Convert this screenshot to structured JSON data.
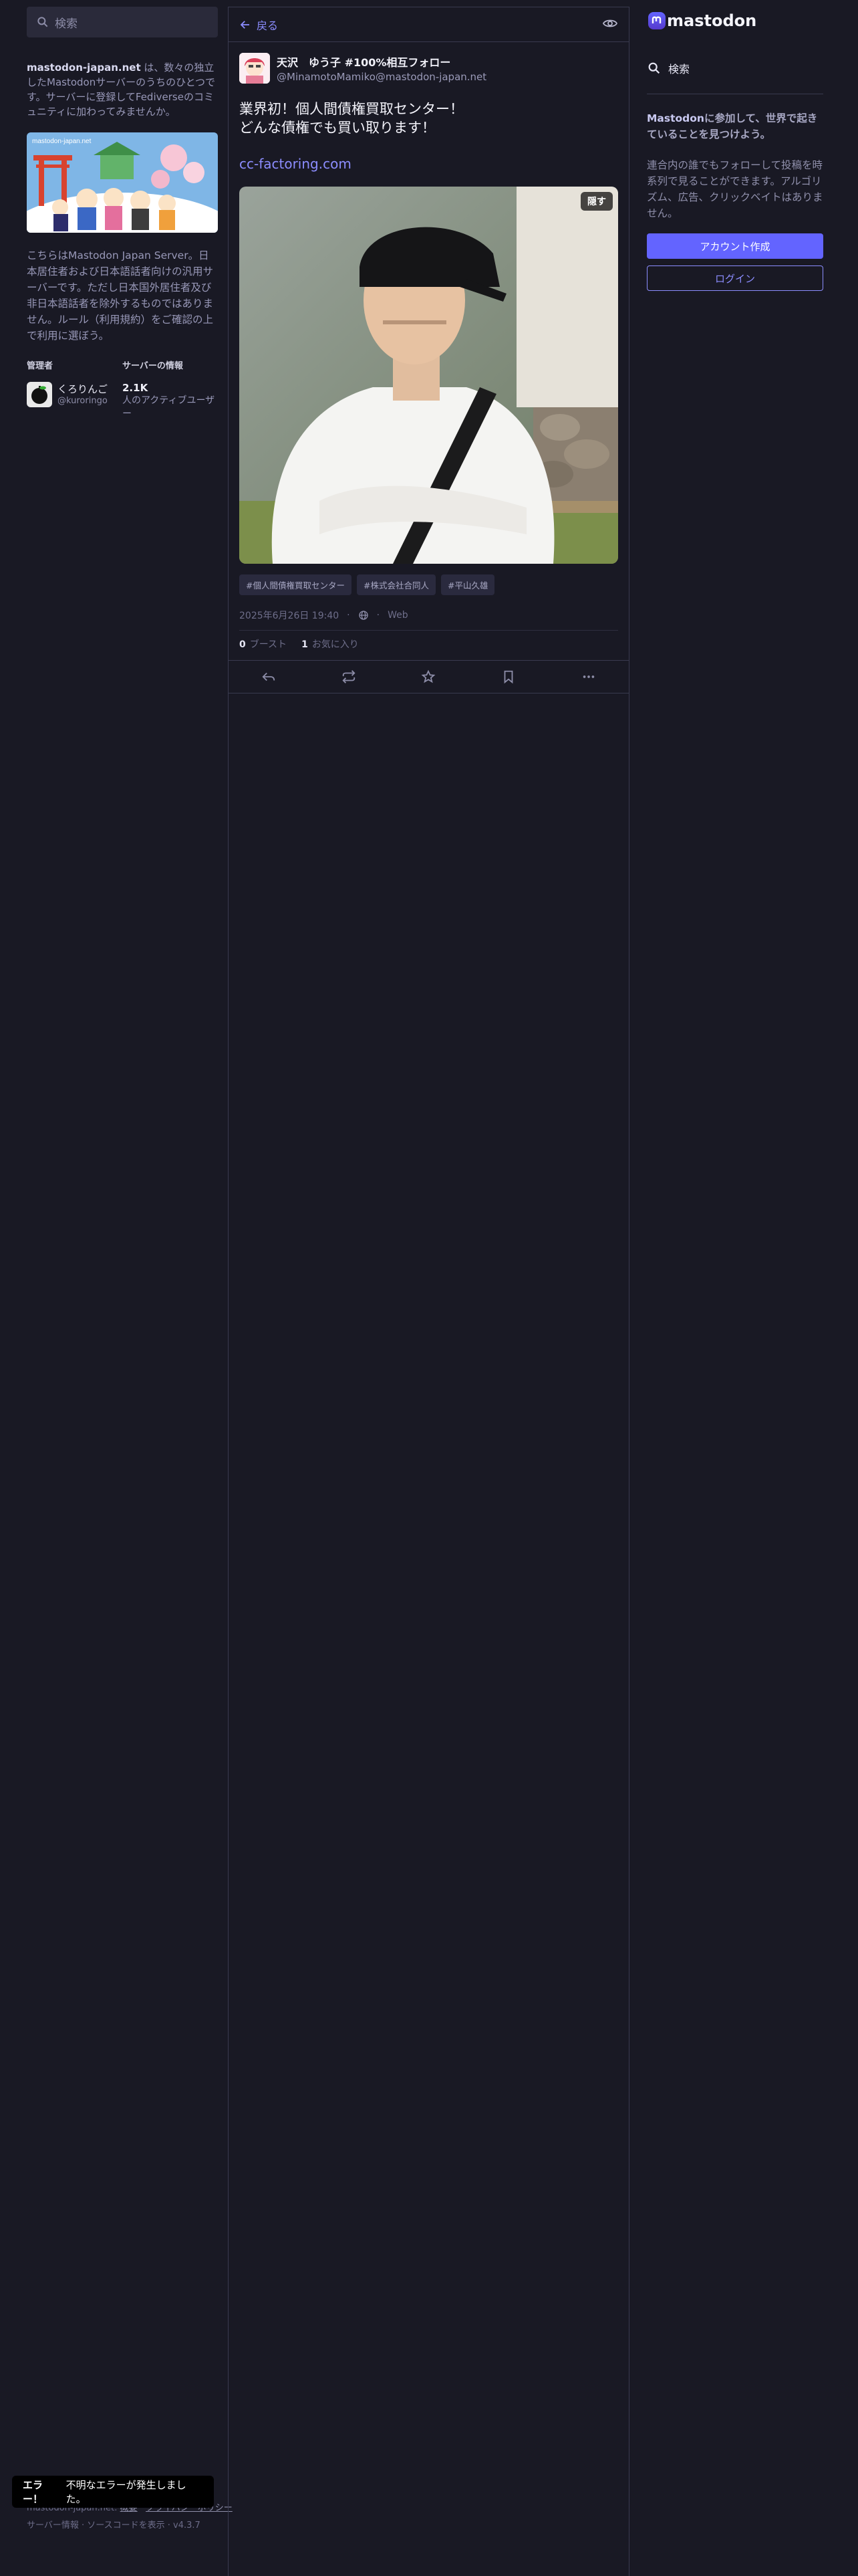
{
  "left": {
    "search_placeholder": "検索",
    "about_server": "mastodon-japan.net",
    "about_text": " は、数々の独立したMastodonサーバーのうちのひとつです。サーバーに登録してFediverseのコミュニティに加わってみませんか。",
    "hero_text": "mastodon-japan.net",
    "description": "こちらはMastodon Japan Server。日本居住者および日本語話者向けの汎用サーバーです。ただし日本国外居住者及び非日本語話者を除外するものではありません。ルール（利用規約）をご確認の上で利用に選ぼう。",
    "admin_heading": "管理者",
    "admin_name": "くろりんご",
    "admin_handle": "@kuroringo",
    "server_heading": "サーバーの情報",
    "active_users_count": "2.1K",
    "active_users_label": "人のアクティブユーザー"
  },
  "footer": {
    "server": "mastodon-japan.net:",
    "about": "概要",
    "privacy": "プライバシーポリシー",
    "line2": "サーバー情報 · ソースコードを表示 · v4.3.7"
  },
  "toast": {
    "title": "エラー！",
    "message": "不明なエラーが発生しました。"
  },
  "topbar": {
    "back_label": "戻る"
  },
  "post": {
    "display_name": "天沢　ゆう子 #100%相互フォロー",
    "acct": "@MinamotoMamiko@mastodon-japan.net",
    "content_line1": "業界初！個人間債権買取センター！",
    "content_line2": "どんな債権でも買い取ります！",
    "link": "cc-factoring.com",
    "hide_label": "隠す",
    "tags": [
      "#個人間債権買取センター",
      "#株式会社合同人",
      "#平山久雄"
    ],
    "timestamp": "2025年6月26日 19:40",
    "via": "Web",
    "boosts_count": "0",
    "boosts_label": "ブースト",
    "favs_count": "1",
    "favs_label": "お気に入り"
  },
  "right": {
    "brand": "mastodon",
    "search_label": "検索",
    "join_brand": "Mastodon",
    "join_text": "に参加して、世界で起きていることを見つけよう。",
    "join_desc": "連合内の誰でもフォローして投稿を時系列で見ることができます。アルゴリズム、広告、クリックベイトはありません。",
    "signup_label": "アカウント作成",
    "login_label": "ログイン"
  },
  "colors": {
    "accent": "#6364ff",
    "background": "#191924",
    "link": "#8c8dff"
  }
}
